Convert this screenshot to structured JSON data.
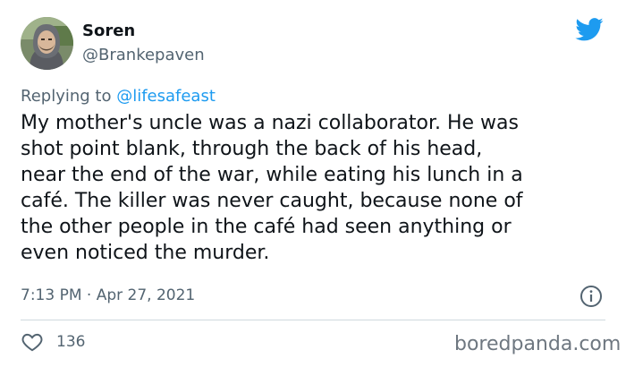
{
  "user": {
    "display_name": "Soren",
    "handle": "@Brankepaven"
  },
  "reply": {
    "prefix": "Replying to ",
    "mention": "@lifesafeast"
  },
  "tweet": {
    "text": "My mother's uncle was a nazi collaborator. He was\nshot point blank, through the back of his head,\nnear the end of the war, while eating his lunch in a\ncafé. The killer was never caught, because none of\nthe other people in the café had seen anything or\neven noticed the murder.",
    "timestamp": "7:13 PM · Apr 27, 2021",
    "likes": "136"
  },
  "icons": {
    "logo": "twitter-bird-icon",
    "info": "info-icon",
    "like": "heart-icon"
  },
  "colors": {
    "accent": "#1d9bf0",
    "text": "#0f1419",
    "muted": "#536471",
    "divider": "#cfd9de"
  },
  "watermark": "boredpanda.com"
}
